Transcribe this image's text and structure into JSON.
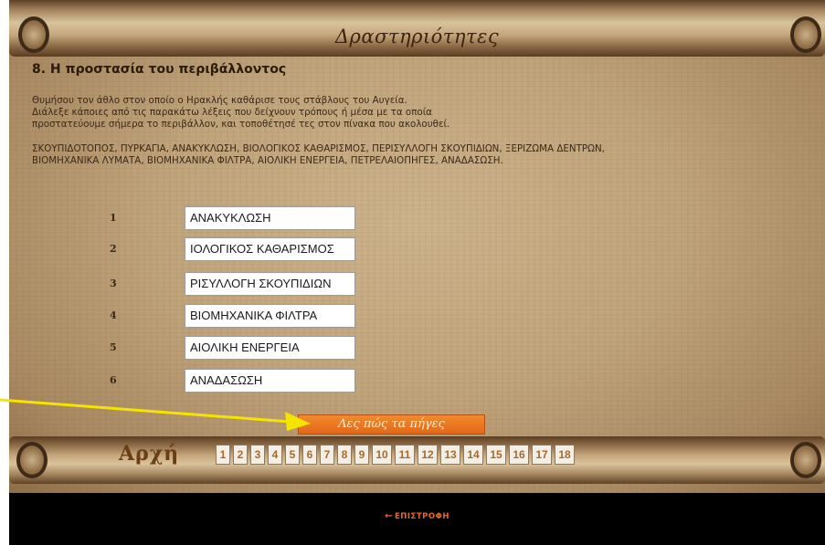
{
  "header": {
    "title": "Δραστηριότητες"
  },
  "activity": {
    "heading": "8. Η προστασία του περιβάλλοντος",
    "intro_lines": [
      "Θυμήσου τον άθλο στον οποίο ο Ηρακλής καθάρισε τους στάβλους του Αυγεία.",
      "Διάλεξε κάποιες από τις παρακάτω λέξεις που δείχνουν τρόπους ή μέσα με τα οποία",
      "προστατεύουμε σήμερα το περιβάλλον, και τοποθέτησέ τες στον πίνακα που ακολουθεί."
    ],
    "word_lines": [
      "ΣΚΟΥΠΙΔΟΤΟΠΟΣ, ΠΥΡΚΑΓΙΑ, ΑΝΑΚΥΚΛΩΣΗ, ΒΙΟΛΟΓΙΚΟΣ ΚΑΘΑΡΙΣΜΟΣ, ΠΕΡΙΣΥΛΛΟΓΗ ΣΚΟΥΠΙΔΙΩΝ, ΞΕΡΙΖΩΜΑ ΔΕΝΤΡΩΝ,",
      "ΒΙΟΜΗΧΑΝΙΚΑ ΛΥΜΑΤΑ, ΒΙΟΜΗΧΑΝΙΚΑ ΦΙΛΤΡΑ, ΑΙΟΛΙΚΗ ΕΝΕΡΓΕΙΑ, ΠΕΤΡΕΛΑΙΟΠΗΓΕΣ, ΑΝΑΔΑΣΩΣΗ."
    ],
    "rows": [
      {
        "num": "1",
        "value": "ΑΝΑΚΥΚΛΩΣΗ"
      },
      {
        "num": "2",
        "value": "ΙΟΛΟΓΙΚΟΣ ΚΑΘΑΡΙΣΜΟΣ"
      },
      {
        "num": "3",
        "value": "ΡΙΣΥΛΛΟΓΗ ΣΚΟΥΠΙΔΙΩΝ"
      },
      {
        "num": "4",
        "value": "ΒΙΟΜΗΧΑΝΙΚΑ ΦΙΛΤΡΑ"
      },
      {
        "num": "5",
        "value": "ΑΙΟΛΙΚΗ ΕΝΕΡΓΕΙΑ"
      },
      {
        "num": "6",
        "value": "ΑΝΑΔΑΣΩΣΗ"
      }
    ],
    "submit_label": "Λες πώς τα πήγες"
  },
  "nav": {
    "home_label": "Αρχή",
    "pages": [
      "1",
      "2",
      "3",
      "4",
      "5",
      "6",
      "7",
      "8",
      "9",
      "10",
      "11",
      "12",
      "13",
      "14",
      "15",
      "16",
      "17",
      "18"
    ]
  },
  "footer": {
    "back_label": "ΕΠΙΣΤΡΟΦΗ"
  },
  "colors": {
    "arrow": "#f5e400",
    "button": "#e9741f",
    "footer_bg": "#000000",
    "back_link": "#e06a28"
  }
}
